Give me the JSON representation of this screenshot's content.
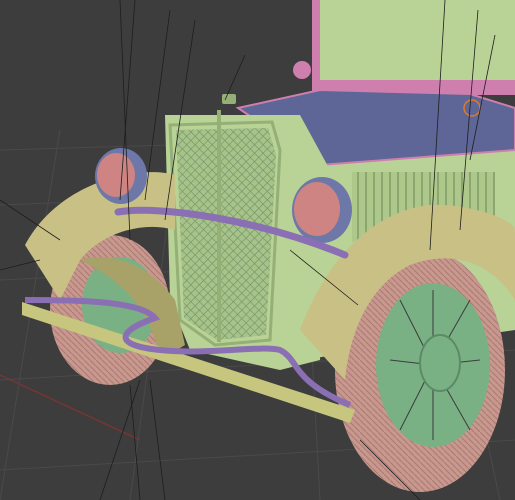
{
  "viewport": {
    "background": "#3d3d3d",
    "grid_color": "#4a4a4a",
    "axis_x_color": "#7a3434",
    "selected_object_outline": "#e07a2a"
  },
  "materials": {
    "body_green": "#b9d296",
    "body_green_dark": "#94b077",
    "cab_pink": "#cf7fae",
    "hood_blue": "#5d6697",
    "fender_tan": "#c9c086",
    "fender_tan_dark": "#a9a268",
    "bumper_tan": "#c6c67f",
    "tire_pink": "#c8988f",
    "headlamp_pink": "#cd8482",
    "headlamp_blue": "#6d78a8",
    "trim_purple": "#8a6fb4",
    "wheel_green": "#79b184",
    "grille_mesh": "#6e9468"
  },
  "object": {
    "name_icon": "vintage-car-3d-model-icon"
  }
}
